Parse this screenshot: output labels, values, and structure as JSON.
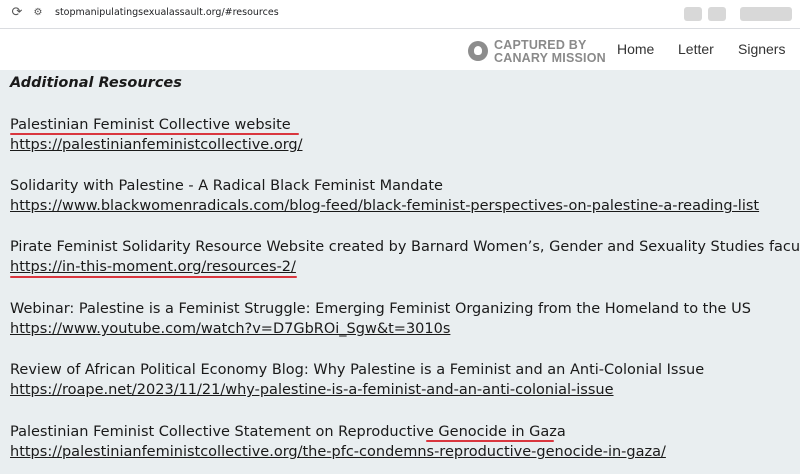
{
  "browser": {
    "url": "stopmanipulatingsexualassault.org/#resources"
  },
  "header": {
    "stamp_text_line1": "CAPTURED BY",
    "stamp_text_line2": "CANARY MISSION",
    "nav": [
      "Home",
      "Letter",
      "Signers"
    ]
  },
  "main": {
    "heading": "Additional Resources",
    "resources": [
      {
        "title": "Palestinian Feminist Collective website",
        "link": "https://palestinianfeministcollective.org/"
      },
      {
        "title": "Solidarity with Palestine - A Radical Black Feminist Mandate",
        "link": "https://www.blackwomenradicals.com/blog-feed/black-feminist-perspectives-on-palestine-a-reading-list"
      },
      {
        "title": "Pirate Feminist Solidarity Resource Website created by Barnard Women’s, Gender and Sexuality Studies faculty",
        "link": "https://in-this-moment.org/resources-2/"
      },
      {
        "title": "Webinar: Palestine is a Feminist Struggle: Emerging Feminist Organizing from the Homeland to the US",
        "link": "https://www.youtube.com/watch?v=D7GbROi_Sgw&t=3010s"
      },
      {
        "title": "Review of African Political Economy Blog: Why Palestine is a Feminist and an Anti-Colonial Issue",
        "link": "https://roape.net/2023/11/21/why-palestine-is-a-feminist-and-an-anti-colonial-issue"
      },
      {
        "title_prefix": "Palestinian Feminist Collective Statement on Reproductive ",
        "title_highlight": "Genocide in Gaza",
        "link": "https://palestinianfeministcollective.org/the-pfc-condemns-reproductive-genocide-in-gaza/"
      }
    ]
  },
  "colors": {
    "background": "#e9eef0",
    "annotation_underline": "#d9363e",
    "stamp": "#8a8a8a"
  }
}
